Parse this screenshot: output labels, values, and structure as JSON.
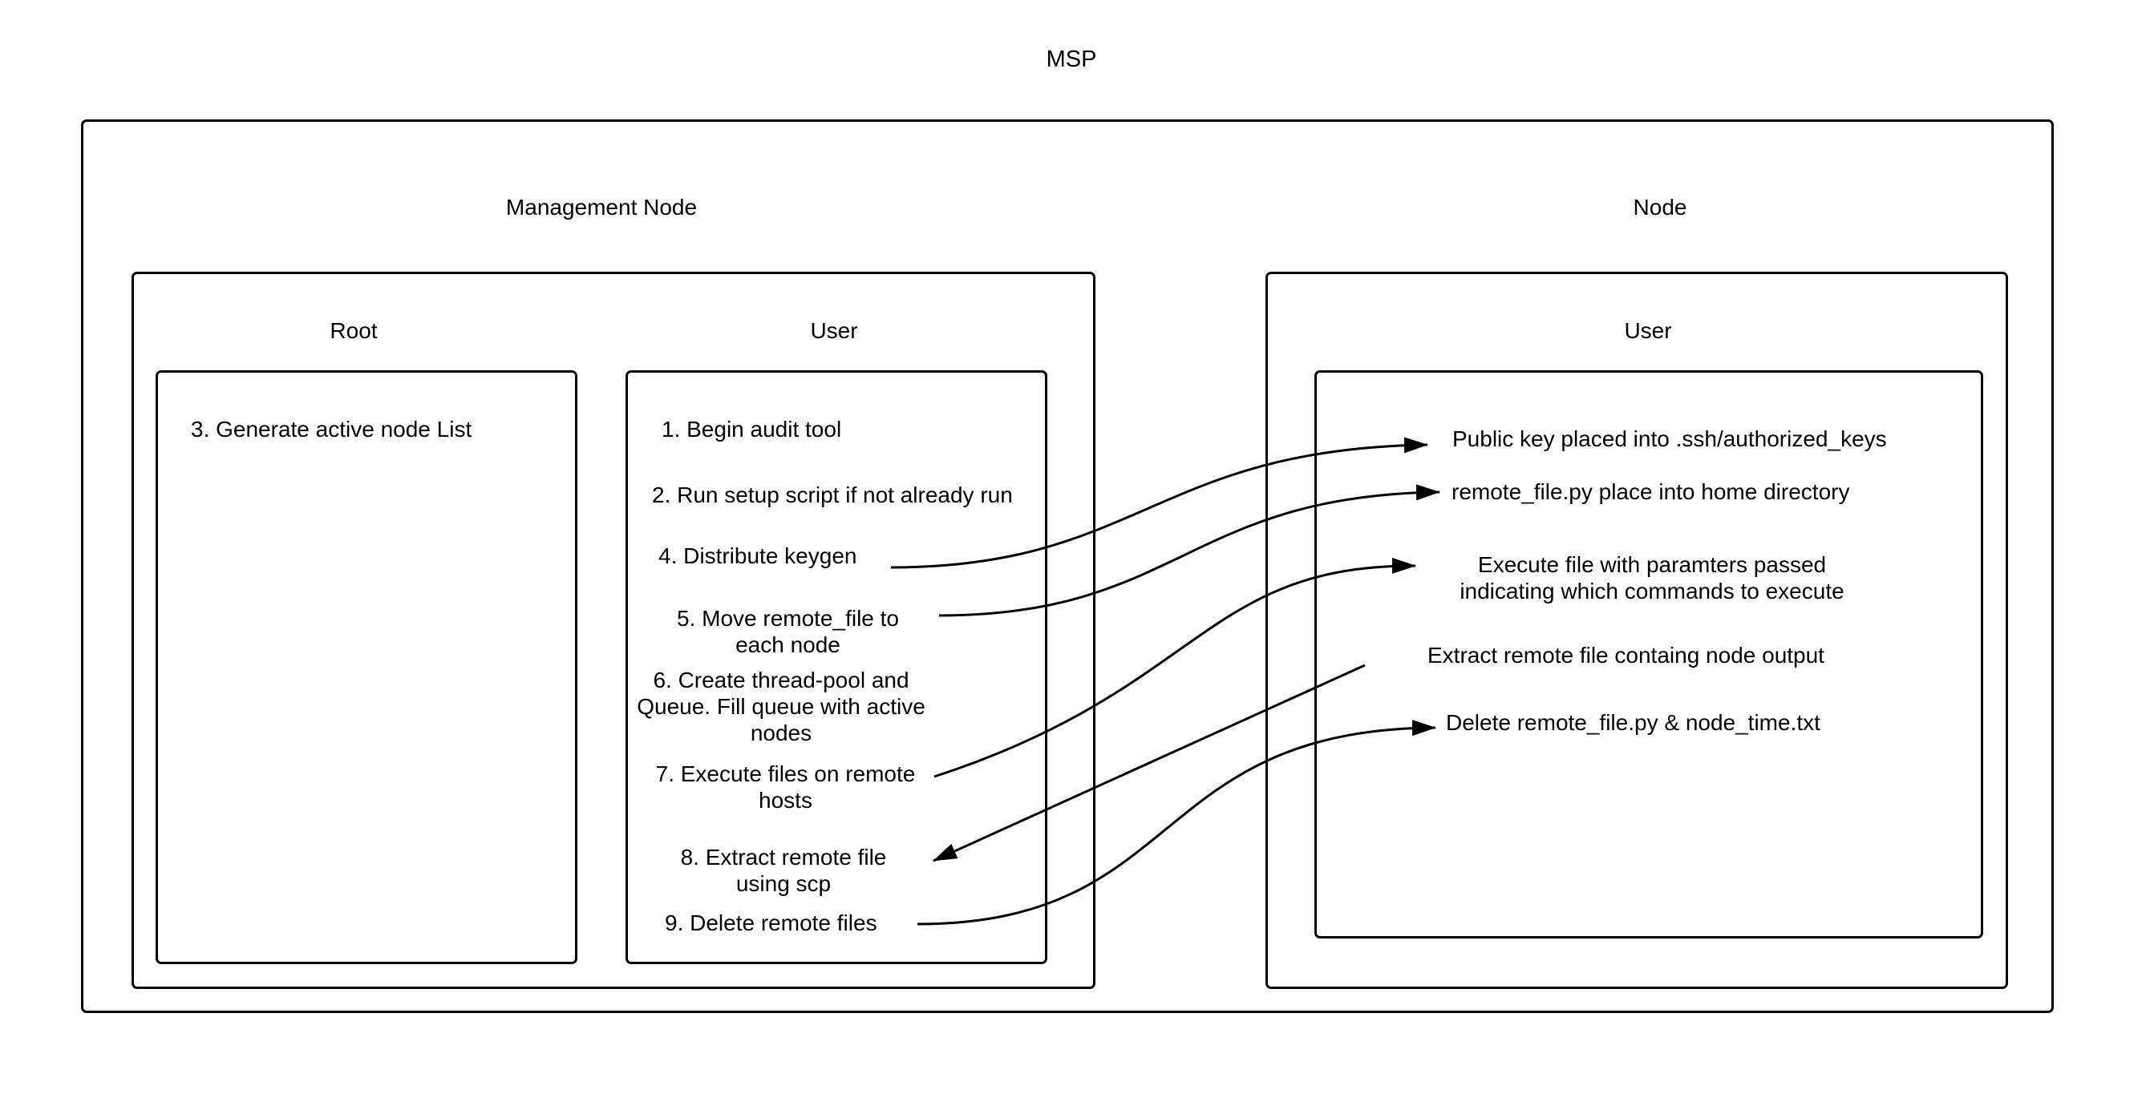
{
  "diagram": {
    "title": "MSP",
    "management_node": {
      "title": "Management Node",
      "root": {
        "title": "Root",
        "steps": [
          "3. Generate active node List"
        ]
      },
      "user": {
        "title": "User",
        "steps": [
          "1. Begin audit tool",
          "2. Run setup script if not already run",
          "4. Distribute keygen",
          "5. Move remote_file to each node",
          "6. Create thread-pool and Queue. Fill queue with active nodes",
          "7. Execute files on remote hosts",
          "8. Extract remote file using scp",
          "9. Delete remote files"
        ]
      }
    },
    "node": {
      "title": "Node",
      "user": {
        "title": "User",
        "items": [
          "Public key placed into .ssh/authorized_keys",
          "remote_file.py place into home directory",
          "Execute file with paramters passed indicating which commands to execute",
          "Extract remote file containg node output",
          "Delete remote_file.py & node_time.txt"
        ]
      }
    },
    "connections": [
      {
        "from": "4. Distribute keygen",
        "to": "Public key placed into .ssh/authorized_keys",
        "direction": "to-node"
      },
      {
        "from": "5. Move remote_file to each node",
        "to": "remote_file.py place into home directory",
        "direction": "to-node"
      },
      {
        "from": "7. Execute files on remote hosts",
        "to": "Execute file with paramters passed indicating which commands to execute",
        "direction": "to-node"
      },
      {
        "from": "Extract remote file containg node output",
        "to": "8. Extract remote file using scp",
        "direction": "to-management"
      },
      {
        "from": "9. Delete remote files",
        "to": "Delete remote_file.py & node_time.txt",
        "direction": "to-node"
      }
    ],
    "colors": {
      "stroke": "#000000",
      "background": "#ffffff"
    }
  }
}
